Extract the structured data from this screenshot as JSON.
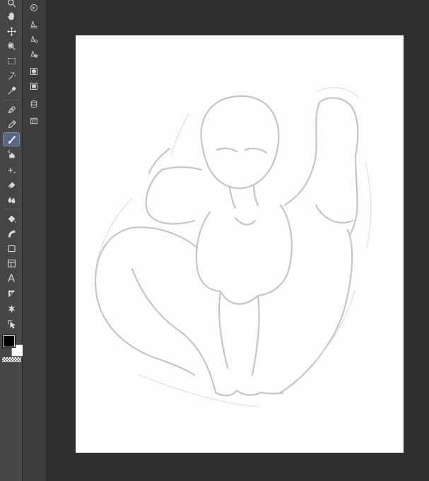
{
  "toolbar": {
    "tools": [
      {
        "id": "zoom",
        "icon": "magnifier-icon"
      },
      {
        "id": "hand",
        "icon": "hand-icon"
      },
      {
        "id": "move",
        "icon": "move-arrows-icon"
      },
      {
        "id": "object",
        "icon": "object-select-icon"
      },
      {
        "id": "selection",
        "icon": "marquee-icon"
      },
      {
        "id": "auto-select",
        "icon": "magic-wand-icon"
      },
      {
        "id": "eyedropper",
        "icon": "eyedropper-icon"
      },
      {
        "id": "pen",
        "icon": "pen-nib-icon"
      },
      {
        "id": "pencil",
        "icon": "pencil-icon"
      },
      {
        "id": "brush",
        "icon": "brush-icon",
        "active": true
      },
      {
        "id": "airbrush",
        "icon": "airbrush-icon"
      },
      {
        "id": "decoration",
        "icon": "sparkle-plus-icon"
      },
      {
        "id": "eraser",
        "icon": "eraser-icon"
      },
      {
        "id": "blend",
        "icon": "blend-drops-icon"
      },
      {
        "id": "fill",
        "icon": "paint-bucket-icon"
      },
      {
        "id": "gradient",
        "icon": "gradient-icon"
      },
      {
        "id": "figure",
        "icon": "rectangle-icon"
      },
      {
        "id": "frame",
        "icon": "frame-border-icon"
      },
      {
        "id": "text",
        "icon": "text-icon",
        "glyph": "A"
      },
      {
        "id": "balloon",
        "icon": "balloon-icon"
      },
      {
        "id": "correct-line",
        "icon": "starburst-icon"
      },
      {
        "id": "operation",
        "icon": "cursor-pointer-icon"
      }
    ],
    "colors": {
      "main": "#000000",
      "sub": "#ffffff",
      "active_highlight": "#596783"
    }
  },
  "sub_toolbar": {
    "items": [
      {
        "id": "sub-1",
        "icon": "circle-arrow-icon"
      },
      {
        "id": "sub-2",
        "icon": "pen-layer-icon"
      },
      {
        "id": "sub-3",
        "icon": "pen-settings-icon"
      },
      {
        "id": "sub-4",
        "icon": "pen-gear-icon"
      },
      {
        "id": "sub-5",
        "icon": "circle-layer-icon"
      },
      {
        "id": "sub-6",
        "icon": "square-layer-icon"
      },
      {
        "id": "sub-7",
        "icon": "cylinder-layer-icon"
      },
      {
        "id": "sub-8",
        "icon": "grid-panel-icon"
      }
    ]
  },
  "canvas": {
    "background": "#2f2f2f",
    "paper": "#fefefe",
    "sketch_stroke": "#b8b8bc"
  }
}
